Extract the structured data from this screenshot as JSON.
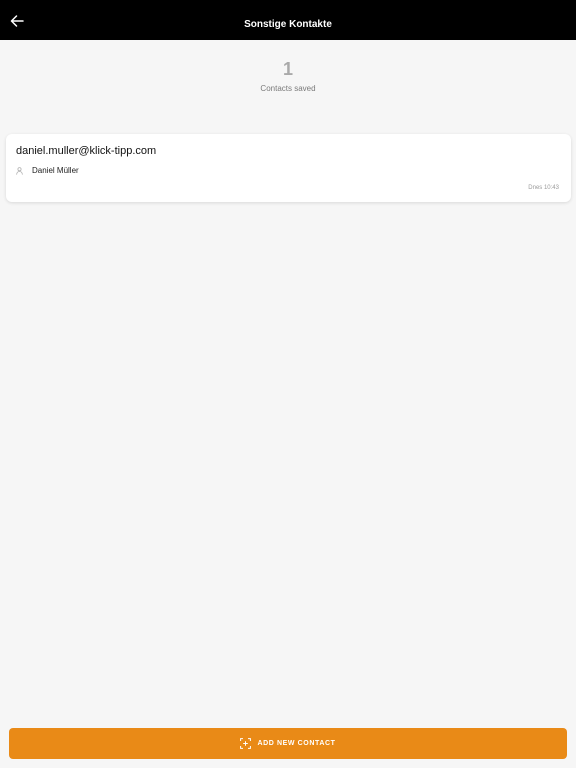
{
  "header": {
    "title": "Sonstige Kontakte",
    "back_icon": "arrow-left-icon"
  },
  "summary": {
    "count": "1",
    "label": "Contacts saved"
  },
  "contacts": [
    {
      "email": "daniel.muller@klick-tipp.com",
      "name": "Daniel Müller",
      "person_icon": "person-icon",
      "time": "Dnes 10:43"
    }
  ],
  "footer": {
    "add_button_label": "ADD NEW CONTACT",
    "add_button_icon": "scan-add-icon",
    "accent_color": "#e98a17"
  }
}
